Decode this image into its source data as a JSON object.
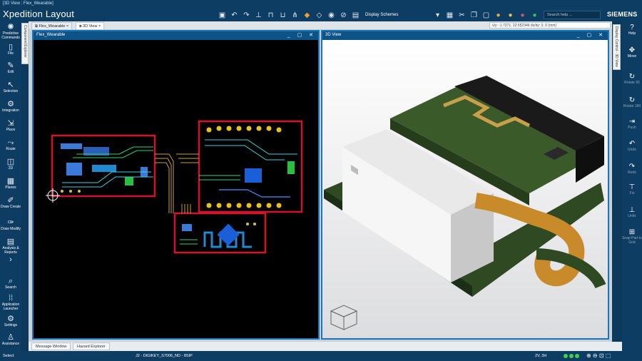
{
  "window_title": "[3D View : Flex_Wearable]",
  "app_name": "Xpedition Layout",
  "brand": "SIEMENS",
  "toolbar": {
    "display_schemes": "Display Schemes",
    "search_placeholder": "Search help ..."
  },
  "left_rail": [
    {
      "label": "Predictive Commands",
      "icon": "spark-icon"
    },
    {
      "label": "File",
      "icon": "file-icon"
    },
    {
      "label": "Edit",
      "icon": "pencil-icon"
    },
    {
      "label": "Selection",
      "icon": "cursor-icon"
    },
    {
      "label": "Integration",
      "icon": "gear-icon"
    },
    {
      "label": "Place",
      "icon": "place-icon"
    },
    {
      "label": "Route",
      "icon": "route-icon"
    },
    {
      "label": "3D",
      "icon": "cube-icon"
    },
    {
      "label": "Planes",
      "icon": "planes-icon"
    },
    {
      "label": "Draw Create",
      "icon": "draw-icon"
    },
    {
      "label": "Draw Modify",
      "icon": "draw-modify-icon"
    },
    {
      "label": "Analysis & Reports",
      "icon": "report-icon"
    },
    {
      "label": "Search",
      "icon": "search-icon"
    },
    {
      "label": "Application Launcher",
      "icon": "grid-icon"
    },
    {
      "label": "Settings",
      "icon": "gear-icon"
    },
    {
      "label": "Assistance",
      "icon": "person-icon"
    }
  ],
  "right_rail": [
    {
      "label": "Help",
      "icon": "help-icon"
    },
    {
      "label": "Move",
      "icon": "move-icon"
    },
    {
      "label": "Rotate 90",
      "icon": "rotate-icon"
    },
    {
      "label": "Rotate 180",
      "icon": "rotate-icon"
    },
    {
      "label": "Push",
      "icon": "push-icon"
    },
    {
      "label": "Undo",
      "icon": "undo-icon"
    },
    {
      "label": "Redo",
      "icon": "redo-icon"
    },
    {
      "label": "Fix",
      "icon": "fix-icon"
    },
    {
      "label": "Unfix",
      "icon": "unfix-icon"
    },
    {
      "label": "Snap Part to Grid",
      "icon": "snap-icon"
    }
  ],
  "side_tabs": {
    "component_explorer": "Component Explorer",
    "display_control": "Display Control - 3D View"
  },
  "doc_tabs": [
    {
      "label": "Flex_Wearable"
    },
    {
      "label": "3D View"
    }
  ],
  "coord_readout": "x/y: -1.7371, 22.652346  dx/dy: 0, 0  (mm)",
  "panels": {
    "layout_title": "Flex_Wearable",
    "view3d_title": "3D View"
  },
  "bottom_tabs": [
    "Message Window",
    "Hazard Explorer"
  ],
  "status": {
    "left": "Select",
    "center": "J2 - DIGIKEY_S7006_ND - 8SIP",
    "right": "2V, 3H"
  }
}
